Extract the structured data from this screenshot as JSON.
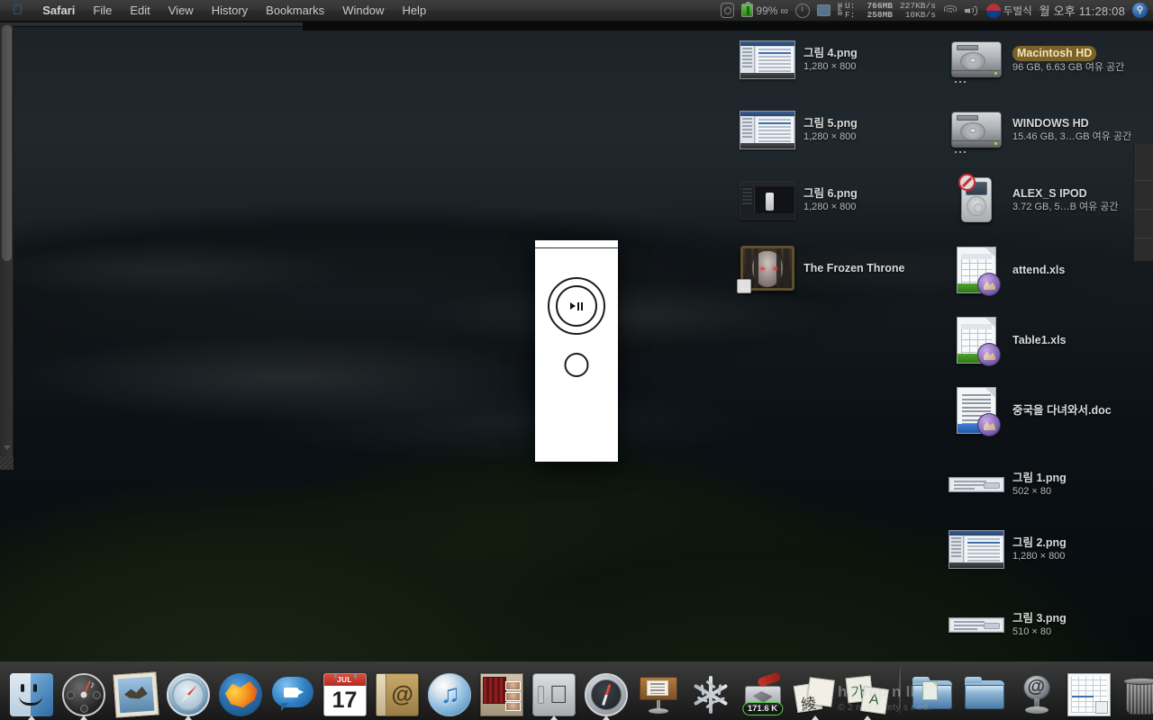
{
  "menubar": {
    "apple_icon": "apple-logo-icon",
    "items": [
      {
        "label": "Safari",
        "bold": true
      },
      {
        "label": "File",
        "bold": false
      },
      {
        "label": "Edit",
        "bold": false
      },
      {
        "label": "View",
        "bold": false
      },
      {
        "label": "History",
        "bold": false
      },
      {
        "label": "Bookmarks",
        "bold": false
      },
      {
        "label": "Window",
        "bold": false
      },
      {
        "label": "Help",
        "bold": false
      }
    ],
    "extras": {
      "eject_icon": "eject-disc-icon",
      "battery_icon": "battery-icon",
      "battery_label": "99%",
      "battery_infinity": "∞",
      "timemachine_icon": "time-machine-icon",
      "display_icon": "display-icon",
      "mem_vertical": [
        "M",
        "E",
        "M"
      ],
      "mem_used_label": "U:",
      "mem_used_value": "766MB",
      "mem_free_label": "F:",
      "mem_free_value": "258MB",
      "net_down": "227KB/s",
      "net_up": "10KB/s",
      "wifi_icon": "wifi-icon",
      "volume_icon": "volume-icon",
      "flag_icon": "korean-flag-icon",
      "input_method": "두벌식",
      "clock": "월 오후 11:28:08",
      "spotlight_icon": "spotlight-search-icon"
    }
  },
  "desktop_icons": {
    "column_middle": [
      {
        "name": "그림 4.png",
        "sub": "1,280 × 800",
        "kind": "png-screenshot",
        "selected": false
      },
      {
        "name": "그림 5.png",
        "sub": "1,280 × 800",
        "kind": "png-screenshot",
        "selected": false
      },
      {
        "name": "그림 6.png",
        "sub": "1,280 × 800",
        "kind": "png-screenshot-dark",
        "selected": false
      },
      {
        "name": "The Frozen Throne",
        "sub": "",
        "kind": "app-alias",
        "selected": false
      }
    ],
    "column_right": [
      {
        "name": "Macintosh HD",
        "sub": "96 GB, 6.63 GB 여유 공간",
        "kind": "harddisk",
        "selected": true
      },
      {
        "name": "WINDOWS HD",
        "sub": "15.46 GB, 3…GB 여유 공간",
        "kind": "harddisk",
        "selected": false
      },
      {
        "name": "ALEX_S IPOD",
        "sub": "3.72 GB, 5…B 여유 공간",
        "kind": "ipod",
        "selected": false
      },
      {
        "name": "attend.xls",
        "sub": "",
        "kind": "excel",
        "selected": false
      },
      {
        "name": "Table1.xls",
        "sub": "",
        "kind": "excel",
        "selected": false
      },
      {
        "name": "중국을 다녀와서.doc",
        "sub": "",
        "kind": "word",
        "selected": false
      },
      {
        "name": "그림 1.png",
        "sub": "502 × 80",
        "kind": "png-strip",
        "selected": false
      },
      {
        "name": "그림 2.png",
        "sub": "1,280 × 800",
        "kind": "png-screenshot",
        "selected": false
      },
      {
        "name": "그림 3.png",
        "sub": "510 × 80",
        "kind": "png-strip",
        "selected": false
      }
    ]
  },
  "remote_window": {
    "title": "",
    "play_pause_icon": "play-pause-icon",
    "menu_button_icon": "circle-button-icon"
  },
  "dock": {
    "items": [
      {
        "name": "finder",
        "label": "Finder",
        "running": true,
        "badge": ""
      },
      {
        "name": "dashboard",
        "label": "Dashboard",
        "running": true,
        "badge": ""
      },
      {
        "name": "mail",
        "label": "Mail",
        "running": false,
        "badge": ""
      },
      {
        "name": "safari",
        "label": "Safari",
        "running": true,
        "badge": ""
      },
      {
        "name": "firefox",
        "label": "Firefox",
        "running": false,
        "badge": ""
      },
      {
        "name": "ichat",
        "label": "iChat",
        "running": false,
        "badge": ""
      },
      {
        "name": "ical",
        "label": "iCal",
        "running": false,
        "badge": ""
      },
      {
        "name": "address-book",
        "label": "Address Book",
        "running": false,
        "badge": ""
      },
      {
        "name": "itunes",
        "label": "iTunes",
        "running": false,
        "badge": ""
      },
      {
        "name": "iphoto",
        "label": "iPhoto",
        "running": false,
        "badge": ""
      },
      {
        "name": "quicktime",
        "label": "QuickTime Player",
        "running": true,
        "badge": ""
      },
      {
        "name": "compass",
        "label": "Compass",
        "running": true,
        "badge": ""
      },
      {
        "name": "keynote",
        "label": "Keynote",
        "running": false,
        "badge": ""
      },
      {
        "name": "snowflake",
        "label": "Snow",
        "running": false,
        "badge": ""
      },
      {
        "name": "transmit",
        "label": "Transmit",
        "running": false,
        "badge": "171.6 K"
      },
      {
        "name": "stickies",
        "label": "Stickies",
        "running": true,
        "badge": ""
      },
      {
        "name": "korean-keyboard",
        "label": "Input Method",
        "running": true,
        "badge": ""
      }
    ],
    "items_right": [
      {
        "name": "documents-folder",
        "label": "Documents",
        "running": false,
        "badge": ""
      },
      {
        "name": "downloads-folder",
        "label": "Downloads",
        "running": false,
        "badge": ""
      },
      {
        "name": "microphone-dock",
        "label": "Podcast",
        "running": false,
        "badge": ""
      },
      {
        "name": "spreadsheet-stack",
        "label": "Spreadsheets",
        "running": false,
        "badge": ""
      },
      {
        "name": "trash",
        "label": "Trash",
        "running": false,
        "badge": ""
      }
    ],
    "ical_month": "JUL",
    "ical_day": "17"
  },
  "watermark": {
    "line1": "h@rap n ll",
    "line2": "© 2    n      phic  iety       s r   ed."
  }
}
